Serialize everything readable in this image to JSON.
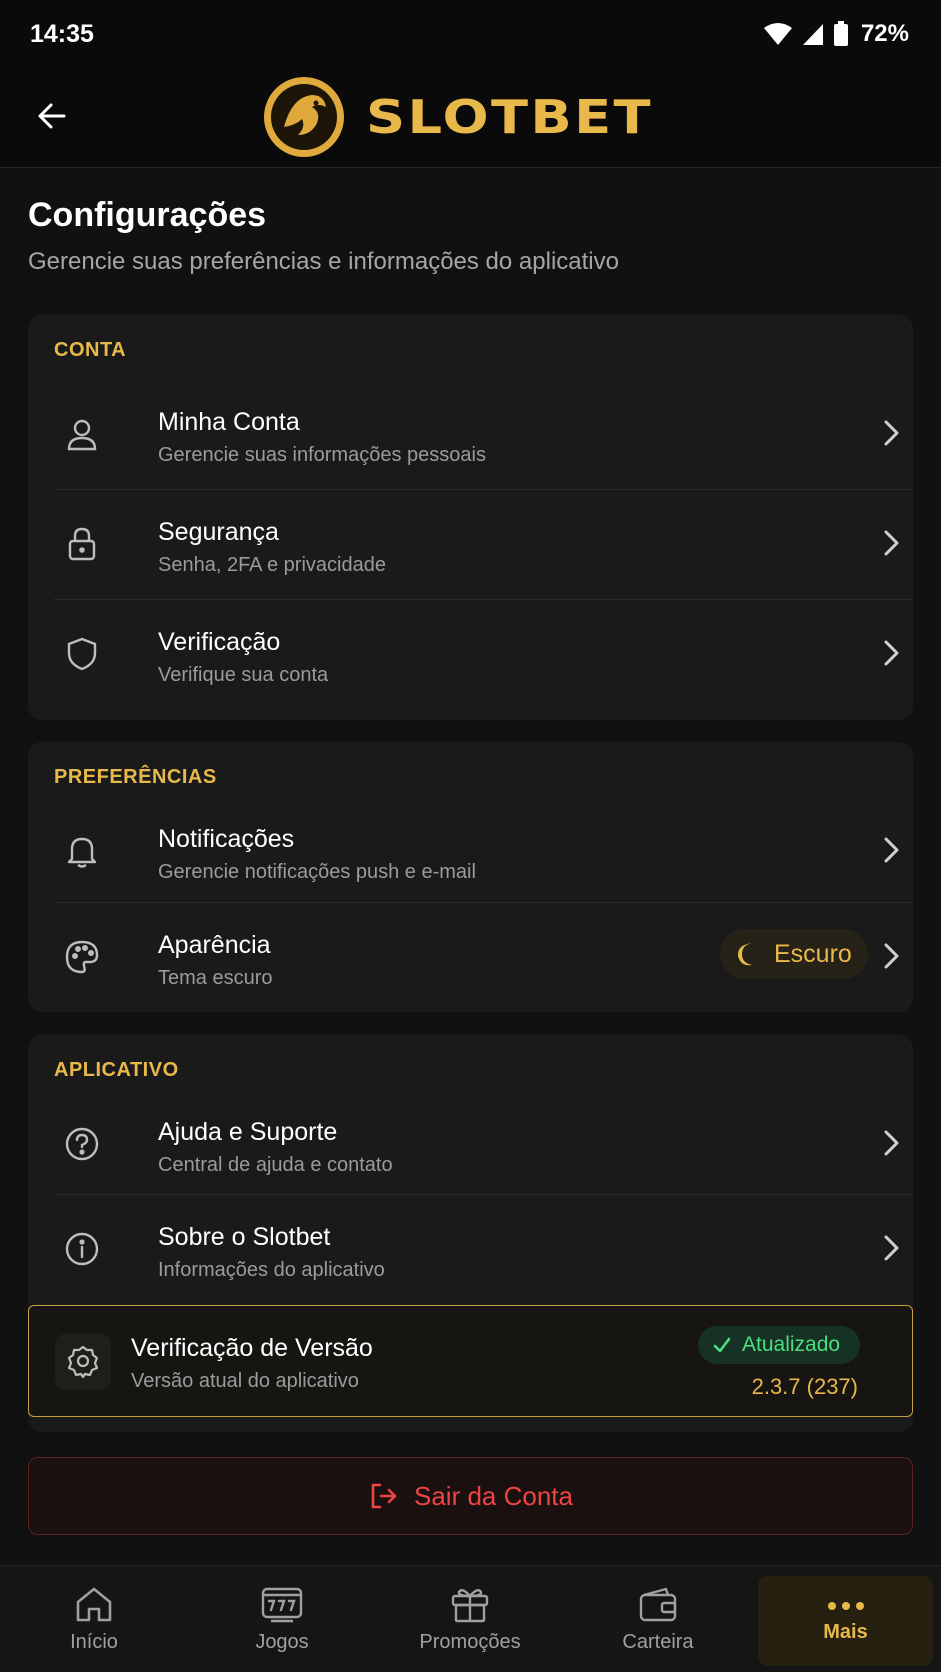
{
  "status_bar": {
    "time": "14:35",
    "battery": "72%"
  },
  "header": {
    "brand": "SLOTBET"
  },
  "page": {
    "title": "Configurações",
    "subtitle": "Gerencie suas preferências e informações do aplicativo"
  },
  "sections": {
    "conta": {
      "label": "CONTA",
      "items": [
        {
          "title": "Minha Conta",
          "subtitle": "Gerencie suas informações pessoais",
          "icon": "user-icon"
        },
        {
          "title": "Segurança",
          "subtitle": "Senha, 2FA e privacidade",
          "icon": "lock-icon"
        },
        {
          "title": "Verificação",
          "subtitle": "Verifique sua conta",
          "icon": "shield-icon"
        }
      ]
    },
    "preferencias": {
      "label": "PREFERÊNCIAS",
      "items": [
        {
          "title": "Notificações",
          "subtitle": "Gerencie notificações push e e-mail",
          "icon": "bell-icon"
        },
        {
          "title": "Aparência",
          "subtitle": "Tema escuro",
          "icon": "palette-icon",
          "badge": "Escuro"
        }
      ]
    },
    "aplicativo": {
      "label": "APLICATIVO",
      "items": [
        {
          "title": "Ajuda e Suporte",
          "subtitle": "Central de ajuda e contato",
          "icon": "help-circle-icon"
        },
        {
          "title": "Sobre o Slotbet",
          "subtitle": "Informações do aplicativo",
          "icon": "info-icon"
        }
      ],
      "version": {
        "title": "Verificação de Versão",
        "subtitle": "Versão atual do aplicativo",
        "status": "Atualizado",
        "number": "2.3.7 (237)"
      }
    }
  },
  "logout_label": "Sair da Conta",
  "nav": [
    {
      "label": "Início",
      "icon": "home-icon"
    },
    {
      "label": "Jogos",
      "icon": "slot-machine-icon"
    },
    {
      "label": "Promoções",
      "icon": "gift-icon"
    },
    {
      "label": "Carteira",
      "icon": "wallet-icon"
    },
    {
      "label": "Mais",
      "icon": "more-dots-icon",
      "active": true
    }
  ],
  "colors": {
    "accent": "#e8b94a",
    "success": "#4ade80",
    "danger": "#ef4444",
    "background": "#111111",
    "card": "#1a1a1a"
  }
}
